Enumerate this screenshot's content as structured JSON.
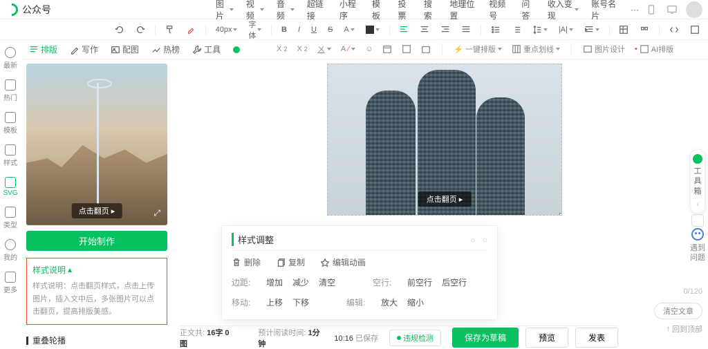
{
  "header": {
    "title": "公众号",
    "menu": [
      "图片",
      "视频",
      "音频",
      "超链接",
      "小程序",
      "模板",
      "投票",
      "搜索",
      "地理位置",
      "视频号",
      "问答",
      "收入变现",
      "账号名片",
      "···"
    ]
  },
  "toolbar": {
    "font_size": "40px",
    "font_family": "字体"
  },
  "subtoolbar": {
    "quick_layout": "一键排版",
    "grid_lines": "重点划线",
    "image_design": "图片设计",
    "ai_layout": "AI排版"
  },
  "leftnav": [
    "最新",
    "热门",
    "模板",
    "样式",
    "SVG",
    "类型",
    "我的",
    "更多"
  ],
  "second_tabs": [
    "排版",
    "写作",
    "配图",
    "热榜",
    "工具"
  ],
  "preview": {
    "tag": "点击翻页",
    "start_button": "开始制作"
  },
  "desc": {
    "title": "样式说明",
    "text": "样式说明：点击翻页样式，点击上传图片，插入文中后，多张图片可以点击翻页，提高排版美感。"
  },
  "section2": "重叠轮播",
  "canvas": {
    "tag": "点击翻页"
  },
  "popup": {
    "title": "样式调整",
    "actions": {
      "delete": "删除",
      "copy": "复制",
      "anim": "编辑动画"
    },
    "row1": {
      "label": "边距:",
      "inc": "增加",
      "dec": "减少",
      "clear": "清空",
      "label2": "空行:",
      "before": "前空行",
      "after": "后空行"
    },
    "row2": {
      "label": "移动:",
      "up": "上移",
      "down": "下移",
      "label2": "编辑:",
      "zoom_in": "放大",
      "zoom_out": "缩小"
    }
  },
  "right_rail": {
    "counter": "0/120",
    "clear": "清空文章",
    "back_top": "回到顶部"
  },
  "status": {
    "count_label": "正文共:",
    "count_val": "16字 0图",
    "time_label": "预计阅读时间:",
    "time_val": "1分钟",
    "saved_time": "10:16",
    "saved_text": "已保存",
    "violate": "违规检测",
    "draft": "保存为草稿",
    "preview": "预览",
    "publish": "发表"
  },
  "float": {
    "toolbox": "工具箱",
    "feedback": "遇到问题"
  }
}
